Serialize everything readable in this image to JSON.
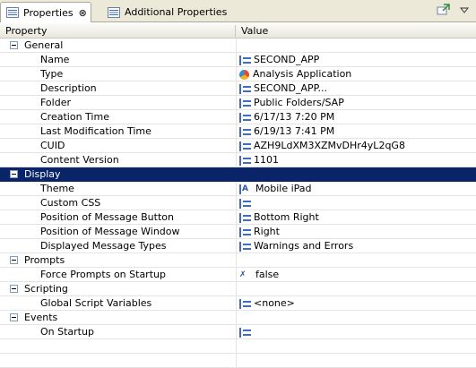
{
  "tabs": [
    {
      "label": "Properties",
      "active": true,
      "close": "⊗"
    },
    {
      "label": "Additional Properties",
      "active": false
    }
  ],
  "columns": {
    "property": "Property",
    "value": "Value"
  },
  "categories": {
    "general": "General",
    "display": "Display",
    "prompts": "Prompts",
    "scripting": "Scripting",
    "events": "Events"
  },
  "props": {
    "name": {
      "label": "Name",
      "value": "SECOND_APP"
    },
    "type": {
      "label": "Type",
      "value": "Analysis Application"
    },
    "description": {
      "label": "Description",
      "value": "SECOND_APP..."
    },
    "folder": {
      "label": "Folder",
      "value": "Public Folders/SAP"
    },
    "creation_time": {
      "label": "Creation Time",
      "value": "6/17/13 7:20 PM"
    },
    "last_mod_time": {
      "label": "Last Modification Time",
      "value": "6/19/13 7:41 PM"
    },
    "cuid": {
      "label": "CUID",
      "value": "AZH9LdXM3XZMvDHr4yL2qG8"
    },
    "content_version": {
      "label": "Content Version",
      "value": "1101"
    },
    "theme": {
      "label": "Theme",
      "value": "Mobile iPad"
    },
    "custom_css": {
      "label": "Custom CSS",
      "value": ""
    },
    "msg_button_pos": {
      "label": "Position of Message Button",
      "value": "Bottom Right"
    },
    "msg_window_pos": {
      "label": "Position of Message Window",
      "value": "Right"
    },
    "msg_types": {
      "label": "Displayed Message Types",
      "value": "Warnings and Errors"
    },
    "force_prompts": {
      "label": "Force Prompts on Startup",
      "value": "false"
    },
    "global_vars": {
      "label": "Global Script Variables",
      "value": "<none>"
    },
    "on_startup": {
      "label": "On Startup",
      "value": ""
    }
  },
  "selected_row": "Display",
  "colors": {
    "selection": "#0a246a",
    "tabbar": "#ece9d8",
    "icon_blue": "#3d6cc0"
  }
}
